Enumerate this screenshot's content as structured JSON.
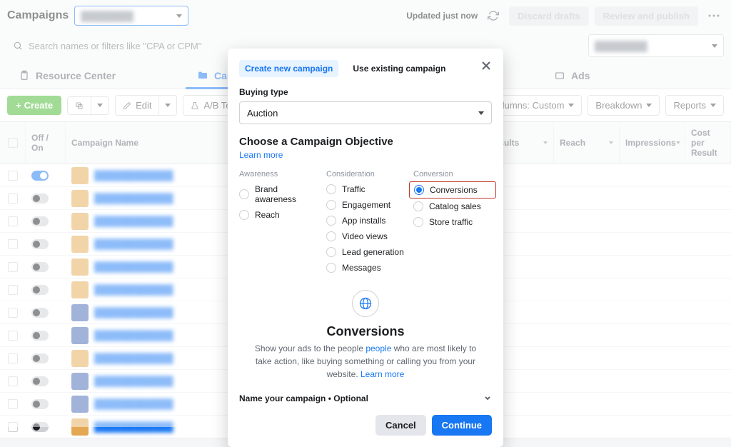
{
  "topbar": {
    "title": "Campaigns",
    "account_placeholder": "Account selector",
    "updated": "Updated just now",
    "discard": "Discard drafts",
    "review": "Review and publish"
  },
  "search": {
    "placeholder": "Search names or filters like \"CPA or CPM\""
  },
  "tabs": {
    "resource": "Resource Center",
    "campaigns": "Campaigns",
    "ads": "Ads"
  },
  "toolbar": {
    "create": "Create",
    "edit": "Edit",
    "abtest": "A/B Test",
    "columns": "Columns: Custom",
    "breakdown": "Breakdown",
    "reports": "Reports"
  },
  "table": {
    "headers": {
      "off_on": "Off / On",
      "name": "Campaign Name",
      "results": "Results",
      "reach": "Reach",
      "impressions": "Impressions",
      "cpr": "Cost per Result"
    },
    "rows": [
      {
        "on": true
      },
      {
        "on": false
      },
      {
        "on": false
      },
      {
        "on": false
      },
      {
        "on": false
      },
      {
        "on": false
      },
      {
        "on": false
      },
      {
        "on": false
      },
      {
        "on": false
      },
      {
        "on": false
      },
      {
        "on": false
      },
      {
        "on": false
      }
    ]
  },
  "modal": {
    "tab_create": "Create new campaign",
    "tab_use": "Use existing campaign",
    "buying_label": "Buying type",
    "buying_value": "Auction",
    "choose_title": "Choose a Campaign Objective",
    "learn_more": "Learn more",
    "awareness_head": "Awareness",
    "consideration_head": "Consideration",
    "conversion_head": "Conversion",
    "awareness": [
      "Brand awareness",
      "Reach"
    ],
    "consideration": [
      "Traffic",
      "Engagement",
      "App installs",
      "Video views",
      "Lead generation",
      "Messages"
    ],
    "conversion": [
      "Conversions",
      "Catalog sales",
      "Store traffic"
    ],
    "obj_title": "Conversions",
    "obj_desc1": "Show your ads to the people ",
    "obj_people": "people",
    "obj_desc2": " who are most likely to take action, like buying something or calling you from your website. ",
    "name_section": "Name your campaign • Optional",
    "cancel": "Cancel",
    "continue": "Continue"
  }
}
